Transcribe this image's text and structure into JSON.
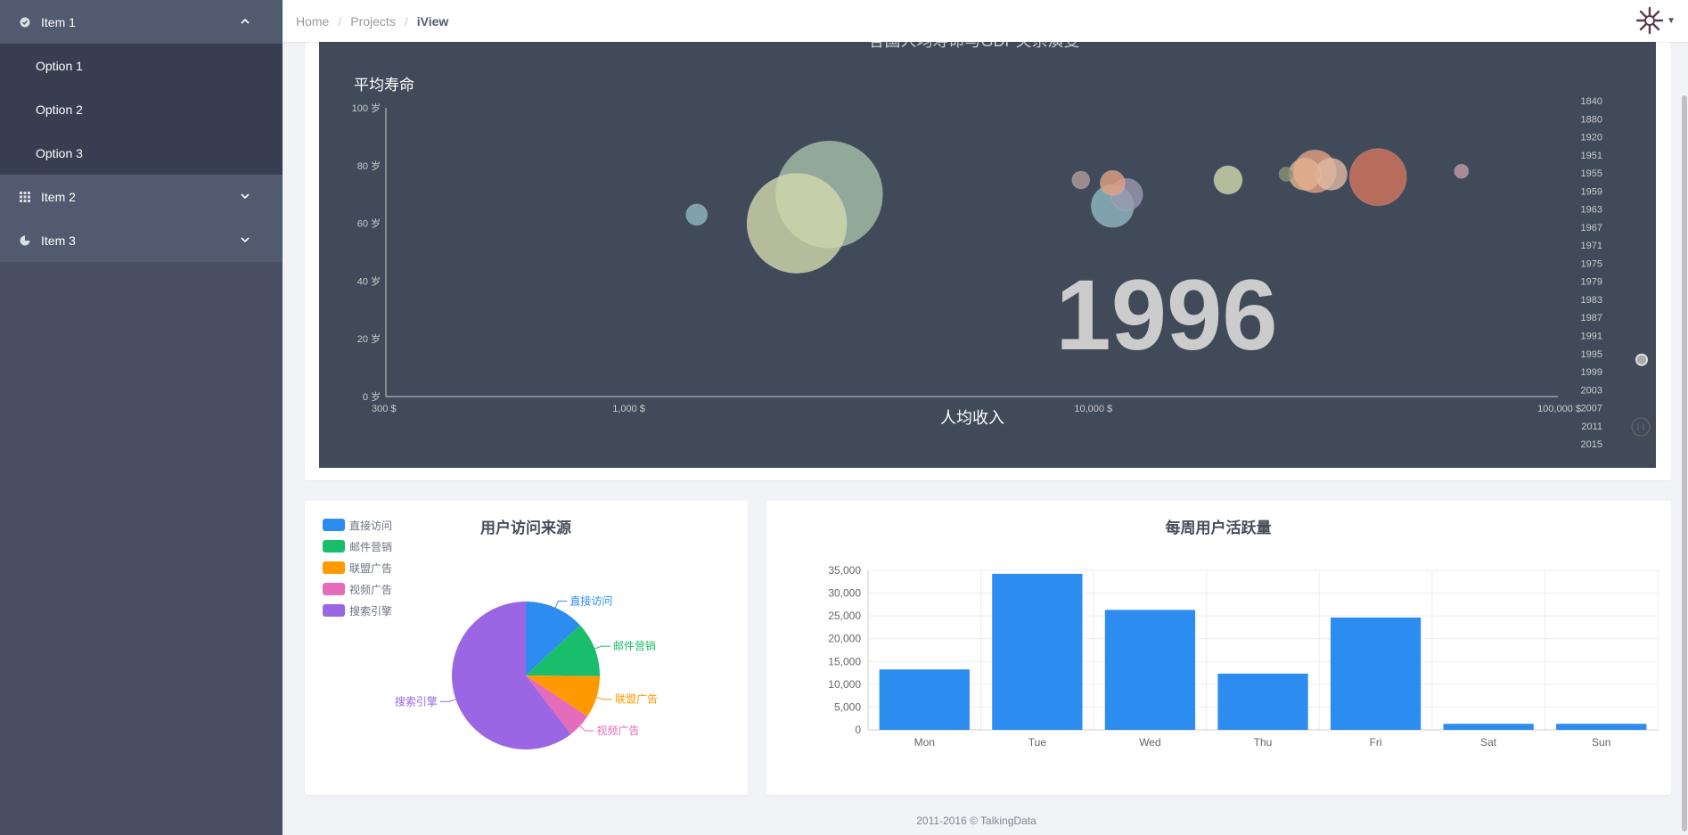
{
  "sidebar": {
    "items": [
      {
        "label": "Item 1",
        "icon": "circle-check-icon",
        "expanded": true,
        "children": [
          "Option 1",
          "Option 2",
          "Option 3"
        ]
      },
      {
        "label": "Item 2",
        "icon": "grid-icon",
        "expanded": false
      },
      {
        "label": "Item 3",
        "icon": "pie-icon",
        "expanded": false
      }
    ]
  },
  "header": {
    "breadcrumb": [
      "Home",
      "Projects",
      "iView"
    ]
  },
  "bubble": {
    "title_partial": "各国人均寿命与GDP关系演变",
    "ylabel": "平均寿命",
    "xlabel": "人均收入",
    "year": "1996",
    "y_ticks": [
      "100 岁",
      "80 岁",
      "60 岁",
      "40 岁",
      "20 岁",
      "0 岁"
    ],
    "x_ticks": [
      "300 $",
      "1,000 $",
      "10,000 $",
      "100,000 $"
    ],
    "timeline_years": [
      "1840",
      "1880",
      "1920",
      "1951",
      "1955",
      "1959",
      "1963",
      "1967",
      "1971",
      "1975",
      "1979",
      "1983",
      "1987",
      "1991",
      "1995",
      "1999",
      "2003",
      "2007",
      "2011",
      "2015"
    ],
    "current_year": "1995",
    "background": "#404a59"
  },
  "pie": {
    "title": "用户访问来源",
    "legend": [
      {
        "name": "直接访问",
        "color": "#2d8cf0"
      },
      {
        "name": "邮件营销",
        "color": "#19be6b"
      },
      {
        "name": "联盟广告",
        "color": "#ff9900"
      },
      {
        "name": "视频广告",
        "color": "#e46cbb"
      },
      {
        "name": "搜索引擎",
        "color": "#9a66e4"
      }
    ]
  },
  "bar": {
    "title": "每周用户活跃量",
    "color": "#2d8cf0"
  },
  "chart_data": [
    {
      "type": "scatter",
      "title": "各国人均寿命与GDP关系演变",
      "xlabel": "人均收入",
      "ylabel": "平均寿命",
      "x_scale": "log",
      "xlim": [
        300,
        100000
      ],
      "ylim": [
        0,
        100
      ],
      "year": "1996",
      "points": [
        {
          "x": 1400,
          "y": 63,
          "size": 6,
          "color": "#8fb8c0"
        },
        {
          "x": 2700,
          "y": 70,
          "size": 30,
          "color": "#a6bfa8"
        },
        {
          "x": 2300,
          "y": 60,
          "size": 28,
          "color": "#d2d8ad"
        },
        {
          "x": 9400,
          "y": 75,
          "size": 5,
          "color": "#b39b99"
        },
        {
          "x": 11000,
          "y": 74,
          "size": 7,
          "color": "#e3a07f"
        },
        {
          "x": 11000,
          "y": 66,
          "size": 12,
          "color": "#8fb8c0"
        },
        {
          "x": 11800,
          "y": 70,
          "size": 9,
          "color": "#9a98b0"
        },
        {
          "x": 19500,
          "y": 75,
          "size": 8,
          "color": "#d2d8ad"
        },
        {
          "x": 26000,
          "y": 77,
          "size": 4,
          "color": "#8a9171"
        },
        {
          "x": 30000,
          "y": 78,
          "size": 12,
          "color": "#e3a07f"
        },
        {
          "x": 32500,
          "y": 77,
          "size": 9,
          "color": "#e0b9a3"
        },
        {
          "x": 28500,
          "y": 77,
          "size": 9,
          "color": "#e3b08f"
        },
        {
          "x": 41000,
          "y": 76,
          "size": 16,
          "color": "#d6765d"
        },
        {
          "x": 62000,
          "y": 78,
          "size": 4,
          "color": "#c39aa5"
        }
      ]
    },
    {
      "type": "pie",
      "title": "用户访问来源",
      "categories": [
        "直接访问",
        "邮件营销",
        "联盟广告",
        "视频广告",
        "搜索引擎"
      ],
      "values": [
        335,
        310,
        234,
        135,
        1548
      ]
    },
    {
      "type": "bar",
      "title": "每周用户活跃量",
      "categories": [
        "Mon",
        "Tue",
        "Wed",
        "Thu",
        "Fri",
        "Sat",
        "Sun"
      ],
      "values": [
        13253,
        34235,
        26321,
        12340,
        24643,
        1322,
        1324
      ],
      "ylim": [
        0,
        35000
      ],
      "y_ticks": [
        "35,000",
        "30,000",
        "25,000",
        "20,000",
        "15,000",
        "10,000",
        "5,000",
        "0"
      ]
    }
  ],
  "footer": {
    "copyright": "2011-2016 © TalkingData"
  }
}
